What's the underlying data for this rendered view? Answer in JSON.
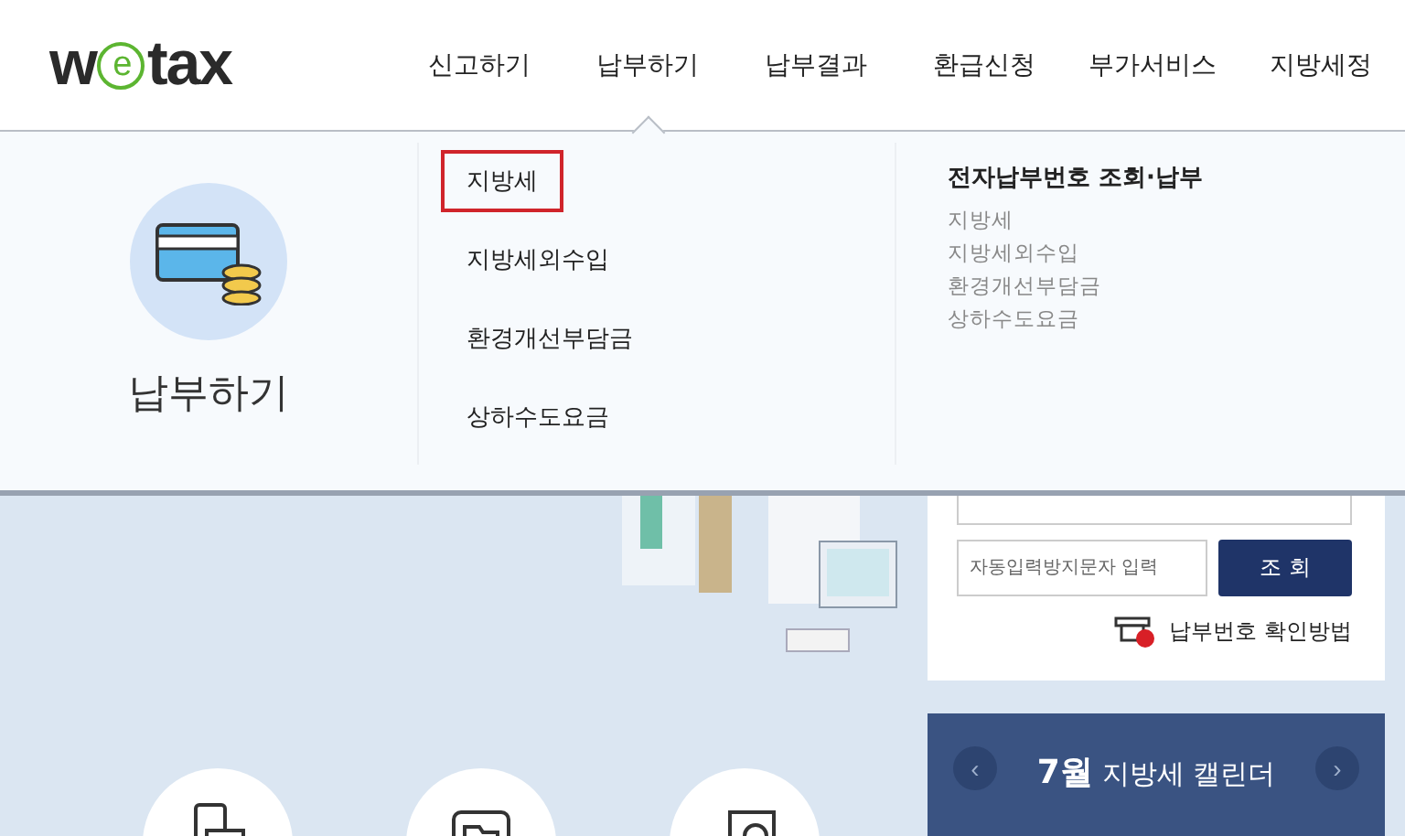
{
  "logo": {
    "before": "w",
    "mark": "e",
    "after": "tax"
  },
  "nav": [
    {
      "label": "신고하기",
      "selected": false
    },
    {
      "label": "납부하기",
      "selected": true
    },
    {
      "label": "납부결과",
      "selected": false
    },
    {
      "label": "환급신청",
      "selected": false
    },
    {
      "label": "부가서비스",
      "selected": false
    },
    {
      "label": "지방세정",
      "selected": false
    }
  ],
  "dropdown": {
    "title": "납부하기",
    "items": [
      {
        "label": "지방세",
        "highlighted": true
      },
      {
        "label": "지방세외수입",
        "highlighted": false
      },
      {
        "label": "환경개선부담금",
        "highlighted": false
      },
      {
        "label": "상하수도요금",
        "highlighted": false
      }
    ],
    "section": {
      "heading": "전자납부번호 조회·납부",
      "links": [
        "지방세",
        "지방세외수입",
        "환경개선부담금",
        "상하수도요금"
      ]
    }
  },
  "lookup": {
    "captcha_placeholder": "자동입력방지문자 입력",
    "button": "조 회",
    "help_link": "납부번호 확인방법"
  },
  "calendar": {
    "month": "7월",
    "title": "지방세 캘린더",
    "prev": "‹",
    "next": "›"
  }
}
